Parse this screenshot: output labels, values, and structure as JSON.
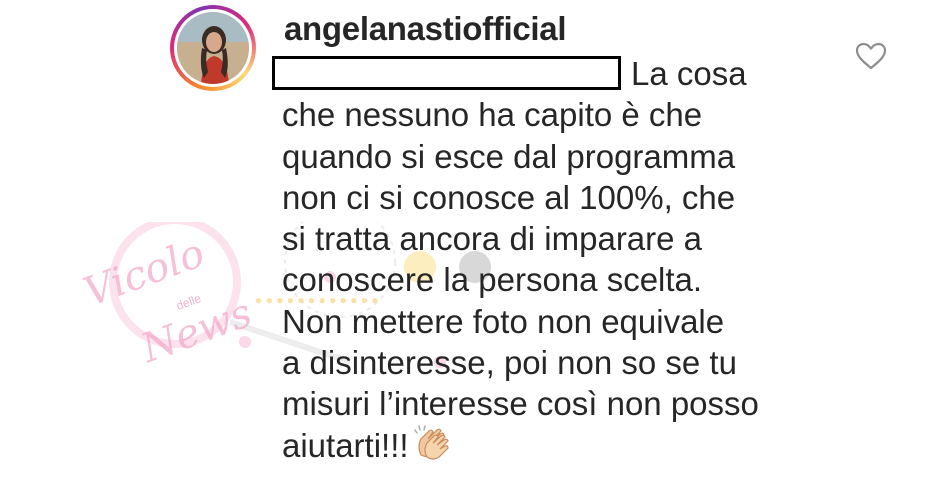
{
  "comment": {
    "username": "angelanastiofficial",
    "lines": [
      "La cosa",
      "che nessuno ha capito è che",
      "quando si esce dal programma",
      "non ci si conosce al 100%, che",
      "si tratta ancora di imparare a",
      "conoscere la persona scelta.",
      "Non mettere foto non equivale",
      "a disinteresse, poi non so se tu",
      "misuri l’interesse così non posso",
      "aiutarti!!!"
    ],
    "emoji_icon": "clapping-hands-icon",
    "like_icon": "heart-outline-icon"
  },
  "watermark": {
    "brand_line1": "Vicolo",
    "brand_small": "delle",
    "brand_line2": "News"
  },
  "colors": {
    "text": "#262626",
    "ring_start": "#f58529",
    "ring_mid": "#dd2a7b",
    "ring_end": "#8134af",
    "watermark": "#f3a6c8"
  }
}
